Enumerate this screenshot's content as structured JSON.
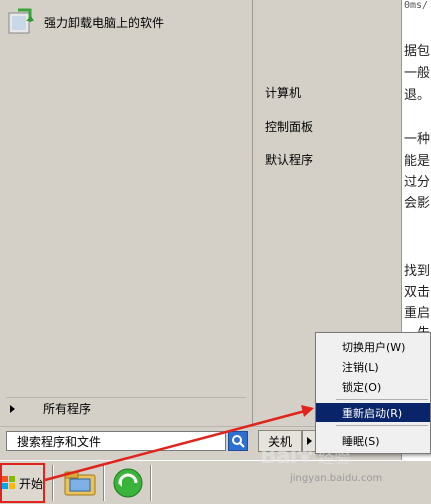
{
  "start_menu": {
    "pinned_program": "强力卸载电脑上的软件",
    "all_programs": "所有程序",
    "right_items": [
      "计算机",
      "控制面板",
      "默认程序"
    ],
    "search_placeholder": "搜索程序和文件",
    "shutdown_label": "关机"
  },
  "power_menu": {
    "items": [
      "切换用户(W)",
      "注销(L)",
      "锁定(O)",
      "重新启动(R)",
      "睡眠(S)"
    ],
    "highlighted": "重新启动(R)"
  },
  "taskbar": {
    "start_label": "开始"
  },
  "background_doc": {
    "lines": [
      "0ms/",
      "据包",
      "一般",
      "退。",
      "一种方",
      "能是",
      "过分",
      "会影",
      "找到",
      "双击",
      "重启",
      "，先"
    ]
  },
  "watermark": {
    "brand": "Bai",
    "text": "经验",
    "url": "jingyan.baidu.com"
  },
  "colors": {
    "highlight": "#0a246a",
    "annotation": "#e0241c",
    "search_button": "#2f6fd0"
  }
}
